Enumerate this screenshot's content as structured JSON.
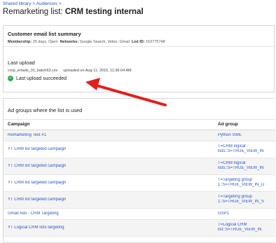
{
  "breadcrumb": {
    "shared_library": "Shared library",
    "sep1": ">",
    "audiences": "Audiences",
    "sep2": ">"
  },
  "title": {
    "prefix": "Remarketing list: ",
    "name": "CRM testing internal"
  },
  "summary": {
    "heading": "Customer email list summary",
    "membership_label": "Membership:",
    "membership_value": "25 days, Open",
    "networks_label": "Networks:",
    "networks_value": "Google Search, Video, Gmail",
    "list_id_label": "List ID:",
    "list_id_value": "152775748"
  },
  "upload": {
    "heading": "Last upload",
    "filename": "corp_emails_01_batch63.csv",
    "uploaded_text": "uploaded on Aug 11, 2015, 11:36:04 AM",
    "status": "Last upload succeeded"
  },
  "adgroups": {
    "heading": "Ad groups where the list is used",
    "columns": {
      "campaign": "Campaign",
      "ad_group": "Ad group"
    },
    "rows": [
      {
        "campaign": "Remarketing Test #1",
        "group1": "Python SWE",
        "group2": ""
      },
      {
        "campaign": "YT CRM list targeted campaign",
        "group1": "T=CRM logical",
        "group2": "lists::S=TRUE_VIEW_IN"
      },
      {
        "campaign": "YT CRM list targeted campaign",
        "group1": "T=CRM logical",
        "group2": "lists::S=TRUE_VIEW_IN"
      },
      {
        "campaign": "YT CRM list targeted campaign",
        "group1": "T=Targeting group",
        "group2": "1::S=TRUE_VIEW_IN_D"
      },
      {
        "campaign": "YT CRM list targeted campaign",
        "group1": "T=Targeting group",
        "group2": "1::S=TRUE_VIEW_IN_S"
      },
      {
        "campaign": "Gmail Ads - CRM Targeting",
        "group1": "GSP1",
        "group2": ""
      },
      {
        "campaign": "YT Logical CRM lists targeting",
        "group1": "T=Logical CRM",
        "group2": "list::S=TRUE_VIEW_IN"
      }
    ]
  },
  "colors": {
    "link": "#2a56c6",
    "success": "#34a853",
    "arrow": "#e0201c"
  },
  "icons": {
    "status": "check-circle-icon"
  }
}
